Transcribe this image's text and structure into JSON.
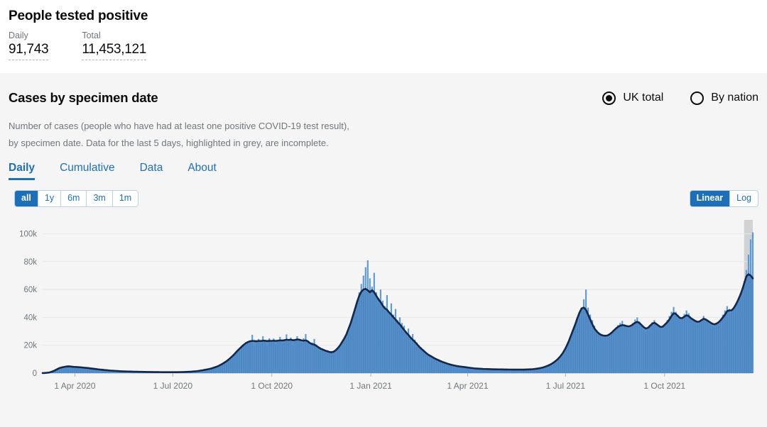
{
  "summary": {
    "title": "People tested positive",
    "metrics": [
      {
        "label": "Daily",
        "value": "91,743"
      },
      {
        "label": "Total",
        "value": "11,453,121"
      }
    ]
  },
  "card": {
    "title": "Cases by specimen date",
    "description_line1": "Number of cases (people who have had at least one positive COVID-19 test result),",
    "description_line2": "by specimen date. Data for the last 5 days, highlighted in grey, are incomplete.",
    "scope_options": [
      {
        "label": "UK total",
        "selected": true
      },
      {
        "label": "By nation",
        "selected": false
      }
    ],
    "tabs": [
      {
        "label": "Daily",
        "active": true
      },
      {
        "label": "Cumulative",
        "active": false
      },
      {
        "label": "Data",
        "active": false
      },
      {
        "label": "About",
        "active": false
      }
    ],
    "range_buttons": [
      {
        "label": "all",
        "active": true
      },
      {
        "label": "1y",
        "active": false
      },
      {
        "label": "6m",
        "active": false
      },
      {
        "label": "3m",
        "active": false
      },
      {
        "label": "1m",
        "active": false
      }
    ],
    "scale_buttons": [
      {
        "label": "Linear",
        "active": true
      },
      {
        "label": "Log",
        "active": false
      }
    ]
  },
  "colors": {
    "bar_fill": "#5596d8",
    "area_fill": "#4d88c4",
    "line": "#12284c",
    "incomplete_grey": "#b1b4b6",
    "link_blue": "#1d70b8",
    "muted_text": "#6f777b",
    "panel_white": "#ffffff",
    "panel_grey": "#f5f5f5"
  },
  "chart_data": {
    "type": "bar",
    "title": "Cases by specimen date",
    "xlabel": "",
    "ylabel": "",
    "grid": true,
    "legend": "none",
    "ylim": [
      0,
      110000
    ],
    "ytick_values": [
      0,
      20000,
      40000,
      60000,
      80000,
      100000
    ],
    "ytick_labels": [
      "0",
      "20k",
      "40k",
      "60k",
      "80k",
      "100k"
    ],
    "xtick_labels": [
      "1 Apr 2020",
      "1 Jul 2020",
      "1 Oct 2020",
      "1 Jan 2021",
      "1 Apr 2021",
      "1 Jul 2021",
      "1 Oct 2021"
    ],
    "xtick_positions": [
      30,
      121,
      213,
      305,
      395,
      486,
      578
    ],
    "x_start_label": "1 Mar 2020",
    "x_end_label": "18 Dec 2021",
    "n_points": 660,
    "incomplete_tail_days": 5,
    "series": [
      {
        "name": "Daily cases (bars)",
        "type": "bar",
        "sample_interval_days": 3,
        "values": [
          40,
          120,
          260,
          480,
          900,
          1500,
          2300,
          3100,
          3900,
          4200,
          4600,
          4900,
          5100,
          4800,
          4600,
          4400,
          4500,
          4300,
          4100,
          4000,
          3800,
          3700,
          3500,
          3300,
          3100,
          2900,
          2700,
          2500,
          2400,
          2200,
          2100,
          1900,
          1800,
          1700,
          1600,
          1500,
          1400,
          1300,
          1250,
          1200,
          1150,
          1100,
          1050,
          1000,
          980,
          950,
          900,
          870,
          840,
          820,
          800,
          780,
          760,
          740,
          720,
          700,
          690,
          680,
          670,
          660,
          650,
          660,
          670,
          690,
          720,
          760,
          800,
          860,
          920,
          1000,
          1100,
          1250,
          1400,
          1600,
          1850,
          2100,
          2400,
          2700,
          3000,
          3400,
          3900,
          4400,
          5000,
          5800,
          6600,
          7600,
          8600,
          9800,
          11200,
          12600,
          14200,
          16000,
          17500,
          19000,
          20500,
          21800,
          22600,
          23200,
          27500,
          19500,
          22800,
          24500,
          21000,
          26500,
          23000,
          19800,
          25000,
          22000,
          24800,
          20500,
          23500,
          26000,
          21500,
          24000,
          27800,
          22500,
          25500,
          20000,
          23800,
          26500,
          24500,
          21800,
          25000,
          28000,
          23000,
          19500,
          22000,
          24500,
          20500,
          18500,
          17500,
          16800,
          16000,
          15500,
          15000,
          14800,
          15200,
          16500,
          18000,
          20000,
          22500,
          25000,
          28000,
          32000,
          36000,
          41000,
          46000,
          52000,
          58000,
          64000,
          70000,
          76000,
          81000,
          68000,
          62000,
          72000,
          58000,
          54000,
          60000,
          52000,
          48000,
          56000,
          44000,
          50000,
          42000,
          46000,
          38000,
          40000,
          36000,
          34000,
          30000,
          32000,
          26000,
          28000,
          24000,
          22000,
          20000,
          18500,
          17000,
          15500,
          14000,
          13000,
          12000,
          11000,
          10200,
          9500,
          8800,
          8200,
          7600,
          7000,
          6500,
          6100,
          5700,
          5400,
          5100,
          4800,
          4600,
          4400,
          4200,
          4000,
          3800,
          3600,
          3400,
          3300,
          3200,
          3100,
          3000,
          2950,
          2900,
          2850,
          2800,
          2750,
          2700,
          2680,
          2650,
          2630,
          2600,
          2580,
          2560,
          2550,
          2540,
          2530,
          2520,
          2510,
          2500,
          2520,
          2560,
          2620,
          2700,
          2800,
          2950,
          3150,
          3400,
          3700,
          4100,
          4600,
          5200,
          5900,
          6700,
          7700,
          8900,
          10300,
          12000,
          14000,
          16500,
          19500,
          23000,
          27000,
          31000,
          35000,
          39000,
          43000,
          47000,
          53000,
          60000,
          47000,
          42000,
          38000,
          34000,
          31000,
          29000,
          27500,
          26500,
          26000,
          25800,
          26500,
          28000,
          30000,
          32500,
          34500,
          36000,
          37500,
          35000,
          33000,
          31500,
          33500,
          36000,
          38500,
          40000,
          37000,
          34000,
          31000,
          29500,
          31000,
          33500,
          36500,
          38000,
          35500,
          33000,
          31500,
          33000,
          35500,
          38000,
          41000,
          44000,
          47500,
          44000,
          41000,
          38500,
          40000,
          42500,
          45000,
          43000,
          40000,
          38000,
          36500,
          35000,
          36500,
          38500,
          41000,
          39000,
          37000,
          35500,
          34000,
          33000,
          34500,
          36500,
          39000,
          42000,
          45000,
          48000,
          46000,
          43500,
          45500,
          48500,
          52000,
          56000,
          60000,
          66000,
          74000,
          85000,
          96000,
          101000
        ]
      },
      {
        "name": "7-day rolling average (line)",
        "type": "line",
        "sample_interval_days": 3,
        "values": [
          30,
          100,
          230,
          430,
          820,
          1400,
          2150,
          2950,
          3700,
          4100,
          4400,
          4700,
          4850,
          4750,
          4550,
          4400,
          4350,
          4250,
          4100,
          3950,
          3800,
          3650,
          3450,
          3280,
          3080,
          2880,
          2680,
          2500,
          2380,
          2200,
          2080,
          1900,
          1790,
          1690,
          1590,
          1490,
          1390,
          1300,
          1240,
          1190,
          1140,
          1090,
          1040,
          1000,
          970,
          940,
          900,
          870,
          840,
          815,
          795,
          775,
          755,
          735,
          715,
          700,
          688,
          678,
          668,
          658,
          652,
          658,
          668,
          688,
          715,
          755,
          798,
          855,
          915,
          995,
          1095,
          1240,
          1395,
          1590,
          1840,
          2090,
          2390,
          2690,
          2990,
          3390,
          3880,
          4380,
          4980,
          5780,
          6580,
          7580,
          8580,
          9780,
          11180,
          12580,
          14180,
          15900,
          17400,
          18900,
          20300,
          21500,
          22300,
          22900,
          23100,
          23000,
          22900,
          23100,
          23000,
          23300,
          23200,
          23000,
          23200,
          23100,
          23300,
          23100,
          23300,
          23500,
          23400,
          23600,
          24000,
          23800,
          24000,
          23600,
          23800,
          24200,
          24000,
          23500,
          23300,
          23500,
          22800,
          21500,
          20800,
          20500,
          19500,
          18500,
          17500,
          16900,
          16200,
          15700,
          15200,
          15000,
          15300,
          16400,
          17900,
          19800,
          22300,
          24800,
          27800,
          31800,
          35800,
          40800,
          45800,
          51000,
          55500,
          58500,
          60000,
          60500,
          59500,
          58000,
          59500,
          58000,
          55500,
          53000,
          51000,
          48500,
          46500,
          45500,
          43500,
          42000,
          40000,
          38500,
          36500,
          35000,
          33000,
          31000,
          29000,
          27500,
          25500,
          24000,
          22500,
          20800,
          19000,
          17500,
          16200,
          14800,
          13500,
          12600,
          11700,
          10800,
          10000,
          9300,
          8600,
          8000,
          7450,
          6900,
          6400,
          6000,
          5600,
          5300,
          5000,
          4750,
          4550,
          4350,
          4150,
          3950,
          3750,
          3560,
          3380,
          3260,
          3160,
          3070,
          2980,
          2930,
          2880,
          2830,
          2780,
          2730,
          2690,
          2670,
          2640,
          2620,
          2590,
          2570,
          2550,
          2540,
          2530,
          2520,
          2510,
          2505,
          2500,
          2520,
          2560,
          2620,
          2700,
          2800,
          2950,
          3150,
          3400,
          3700,
          4100,
          4600,
          5200,
          5900,
          6700,
          7700,
          8900,
          10300,
          12000,
          14000,
          16500,
          19500,
          23000,
          27000,
          31000,
          35000,
          39500,
          43500,
          46500,
          47000,
          45500,
          42000,
          38500,
          35000,
          32000,
          30000,
          28500,
          27500,
          27000,
          26800,
          27000,
          27800,
          29000,
          30500,
          32000,
          33200,
          34000,
          34500,
          34200,
          33800,
          33500,
          34000,
          35000,
          36200,
          36800,
          36000,
          34500,
          33000,
          32000,
          32500,
          34000,
          35500,
          36200,
          35200,
          34000,
          33000,
          33500,
          35000,
          36500,
          38500,
          41000,
          43000,
          42500,
          41000,
          39500,
          39500,
          40500,
          41500,
          41000,
          39500,
          38500,
          37500,
          36800,
          37000,
          38000,
          39000,
          38500,
          37500,
          36500,
          35500,
          35000,
          35500,
          36500,
          38000,
          40000,
          42000,
          44500,
          45000,
          45000,
          46500,
          49000,
          52000,
          55500,
          59500,
          64500,
          69500,
          71000,
          70000,
          68000
        ]
      }
    ]
  }
}
